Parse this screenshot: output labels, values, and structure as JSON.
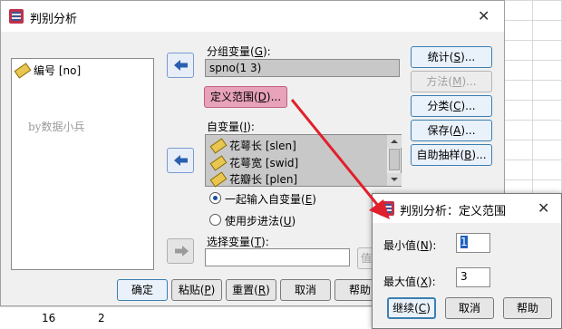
{
  "background": {
    "cells": [
      "16",
      "2"
    ]
  },
  "main_dialog": {
    "title": "判别分析",
    "source_list": {
      "items": [
        {
          "label": "编号 [no]",
          "icon": "ruler-icon"
        }
      ],
      "watermark": "by数据小兵"
    },
    "grouping_variable": {
      "label_pre": "分组变量(",
      "label_key": "G",
      "label_post": "):",
      "value": "spno(1 3)"
    },
    "define_range_button": {
      "pre": "定义范围(",
      "key": "D",
      "post": ")..."
    },
    "independents": {
      "label_pre": "自变量(",
      "label_key": "I",
      "label_post": "):",
      "items": [
        {
          "label": "花萼长 [slen]",
          "icon": "ruler-icon"
        },
        {
          "label": "花萼宽 [swid]",
          "icon": "ruler-icon"
        },
        {
          "label": "花瓣长 [plen]",
          "icon": "ruler-icon"
        }
      ]
    },
    "method_options": [
      {
        "pre": "一起输入自变量(",
        "key": "E",
        "post": ")",
        "selected": true
      },
      {
        "pre": "使用步进法(",
        "key": "U",
        "post": ")",
        "selected": false
      }
    ],
    "selection_variable": {
      "label_pre": "选择变量(",
      "label_key": "T",
      "label_post": "):",
      "value": "",
      "value_button": "值"
    },
    "right_buttons": [
      {
        "pre": "统计(",
        "key": "S",
        "post": ")...",
        "enabled": true
      },
      {
        "pre": "方法(",
        "key": "M",
        "post": ")...",
        "enabled": false
      },
      {
        "pre": "分类(",
        "key": "C",
        "post": ")...",
        "enabled": true
      },
      {
        "pre": "保存(",
        "key": "A",
        "post": ")...",
        "enabled": true
      },
      {
        "pre": "自助抽样(",
        "key": "B",
        "post": ")...",
        "enabled": true
      }
    ],
    "bottom_buttons": [
      {
        "label": "确定"
      },
      {
        "pre": "粘贴(",
        "key": "P",
        "post": ")"
      },
      {
        "pre": "重置(",
        "key": "R",
        "post": ")"
      },
      {
        "label": "取消"
      },
      {
        "label": "帮助"
      }
    ]
  },
  "sub_dialog": {
    "title": "判别分析：定义范围",
    "min": {
      "pre": "最小值(",
      "key": "N",
      "post": "):",
      "value": "1"
    },
    "max": {
      "pre": "最大值(",
      "key": "X",
      "post": "):",
      "value": "3"
    },
    "buttons": [
      {
        "pre": "继续(",
        "key": "C",
        "post": ")"
      },
      {
        "label": "取消"
      },
      {
        "label": "帮助"
      }
    ]
  },
  "colors": {
    "annotation_arrow": "#e0202c",
    "highlight_button": "#e8a2ba",
    "selected_list": "#c8c8c8"
  }
}
